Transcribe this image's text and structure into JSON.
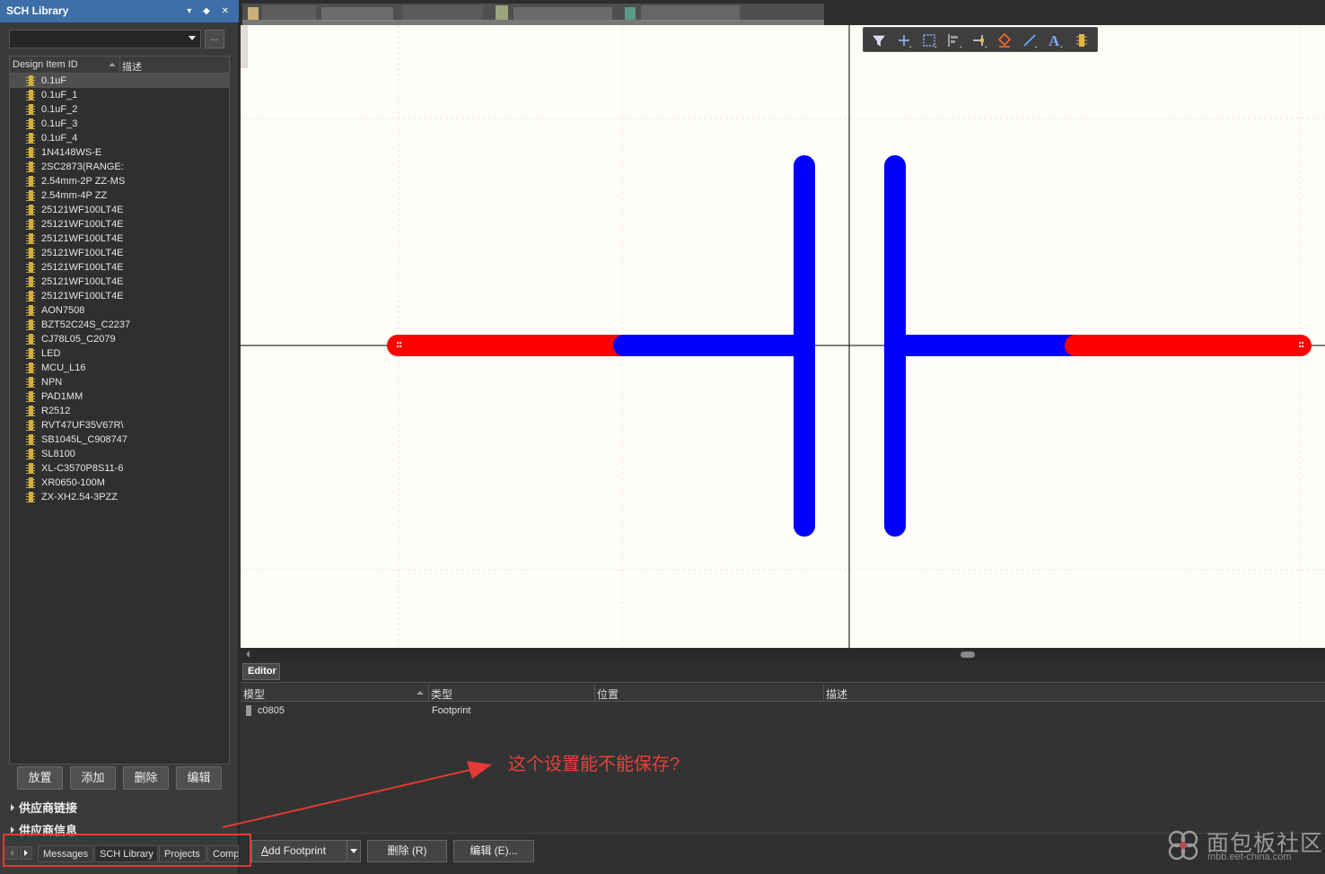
{
  "panel": {
    "title": "SCH Library",
    "controls": "▾ ◆ ✕",
    "filter_value": "",
    "filter_btn": "...",
    "columns": {
      "id": "Design Item ID",
      "desc": "描述"
    },
    "items": [
      "0.1uF",
      "0.1uF_1",
      "0.1uF_2",
      "0.1uF_3",
      "0.1uF_4",
      "1N4148WS-E",
      "2SC2873(RANGE:",
      "2.54mm-2P ZZ-MS",
      "2.54mm-4P ZZ",
      "25121WF100LT4E",
      "25121WF100LT4E",
      "25121WF100LT4E",
      "25121WF100LT4E",
      "25121WF100LT4E",
      "25121WF100LT4E",
      "25121WF100LT4E",
      "AON7508",
      "BZT52C24S_C2237",
      "CJ78L05_C2079",
      "LED",
      "MCU_L16",
      "NPN",
      "PAD1MM",
      "R2512",
      "RVT47UF35V67R\\",
      "SB1045L_C908747",
      "SL8100",
      "XL-C3570P8S11-6",
      "XR0650-100M",
      "ZX-XH2.54-3PZZ"
    ],
    "buttons": {
      "place": "放置",
      "add": "添加",
      "delete": "删除",
      "edit": "编辑"
    },
    "sections": {
      "supplier_links": "供应商链接",
      "supplier_info": "供应商信息"
    },
    "tabs": [
      "Messages",
      "SCH Library",
      "Projects",
      "Comp"
    ]
  },
  "editor": {
    "tab": "Editor",
    "columns": {
      "model": "模型",
      "type": "类型",
      "location": "位置",
      "desc": "描述"
    },
    "rows": [
      {
        "model": "c0805",
        "type": "Footprint",
        "location": "",
        "desc": ""
      }
    ],
    "buttons": {
      "add_footprint": "Add Footprint",
      "delete": "删除 (R)",
      "edit": "编辑 (E)..."
    }
  },
  "annotation": "这个设置能不能保存?",
  "watermark": {
    "main": "面包板社区",
    "sub": "mbb.eet-china.com"
  },
  "toolbar_icons": [
    "filter-icon",
    "cross-icon",
    "select-rect-icon",
    "align-icon",
    "place-pin-icon",
    "paint-icon",
    "line-icon",
    "text-icon",
    "component-icon"
  ],
  "colors": {
    "pin": "#ff0000",
    "body": "#0000ff",
    "canvas": "#fffdf8",
    "accent": "#3d6ea8",
    "annotation": "#e8403a"
  }
}
